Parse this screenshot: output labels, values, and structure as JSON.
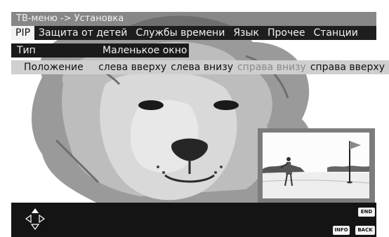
{
  "window": {
    "title": "ТВ-меню -> Установка"
  },
  "tabs": [
    {
      "label": "PIP",
      "active": true
    },
    {
      "label": "Защита от детей",
      "active": false
    },
    {
      "label": "Службы времени",
      "active": false
    },
    {
      "label": "Язык",
      "active": false
    },
    {
      "label": "Прочее",
      "active": false
    },
    {
      "label": "Станции",
      "active": false
    }
  ],
  "settings": {
    "type": {
      "label": "Тип",
      "value": "Маленькое окно"
    },
    "position": {
      "label": "Положение",
      "options": [
        {
          "label": "слева вверху",
          "enabled": true
        },
        {
          "label": "слева внизу",
          "enabled": true
        },
        {
          "label": "справа внизу",
          "enabled": false
        },
        {
          "label": "справа вверху",
          "enabled": true
        }
      ]
    }
  },
  "footer": {
    "nav_icon": "dpad-arrows-icon",
    "keys": {
      "end": "END",
      "info": "INFO",
      "back": "BACK"
    }
  },
  "colors": {
    "title_bar": "#5f5f5f",
    "tab_bar": "#1e1e1e",
    "active_tab": "#f2f2f2",
    "position_row": "#cfcfcf",
    "disabled_text": "#8a8a8a",
    "footer": "#141414"
  }
}
